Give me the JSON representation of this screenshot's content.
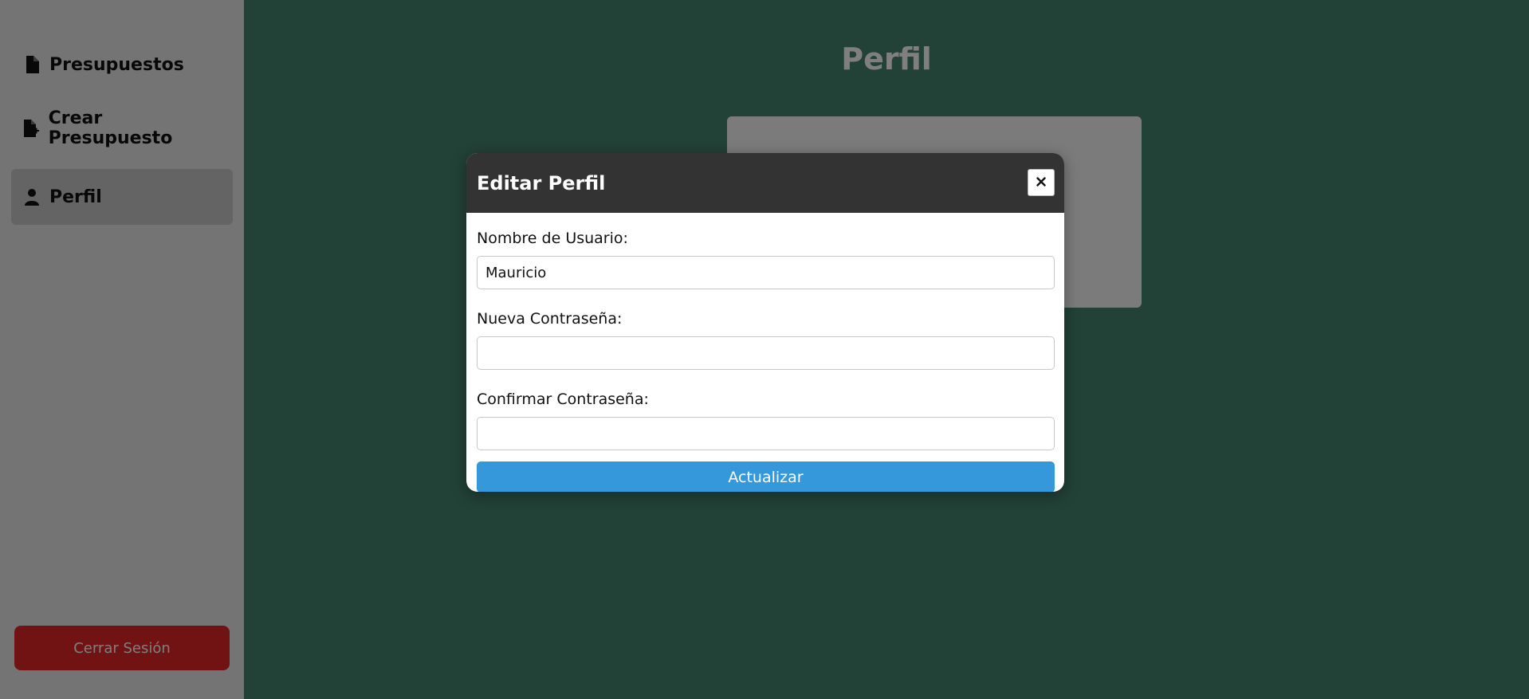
{
  "sidebar": {
    "items": [
      {
        "label": "Presupuestos",
        "icon": "file-icon",
        "active": false
      },
      {
        "label": "Crear Presupuesto",
        "icon": "file-add-icon",
        "active": false
      },
      {
        "label": "Perfil",
        "icon": "user-icon",
        "active": true
      }
    ],
    "logout_label": "Cerrar Sesión"
  },
  "main": {
    "title": "Perfil"
  },
  "modal": {
    "title": "Editar Perfil",
    "close_icon": "close-icon",
    "fields": {
      "username": {
        "label": "Nombre de Usuario:",
        "value": "Mauricio"
      },
      "new_password": {
        "label": "Nueva Contraseña:",
        "value": ""
      },
      "confirm_password": {
        "label": "Confirmar Contraseña:",
        "value": ""
      }
    },
    "submit_label": "Actualizar"
  },
  "colors": {
    "sidebar_bg": "#e9e9e9",
    "main_bg": "#44826e",
    "modal_header_bg": "#333333",
    "submit_bg": "#3498db",
    "logout_bg": "#e32626"
  }
}
